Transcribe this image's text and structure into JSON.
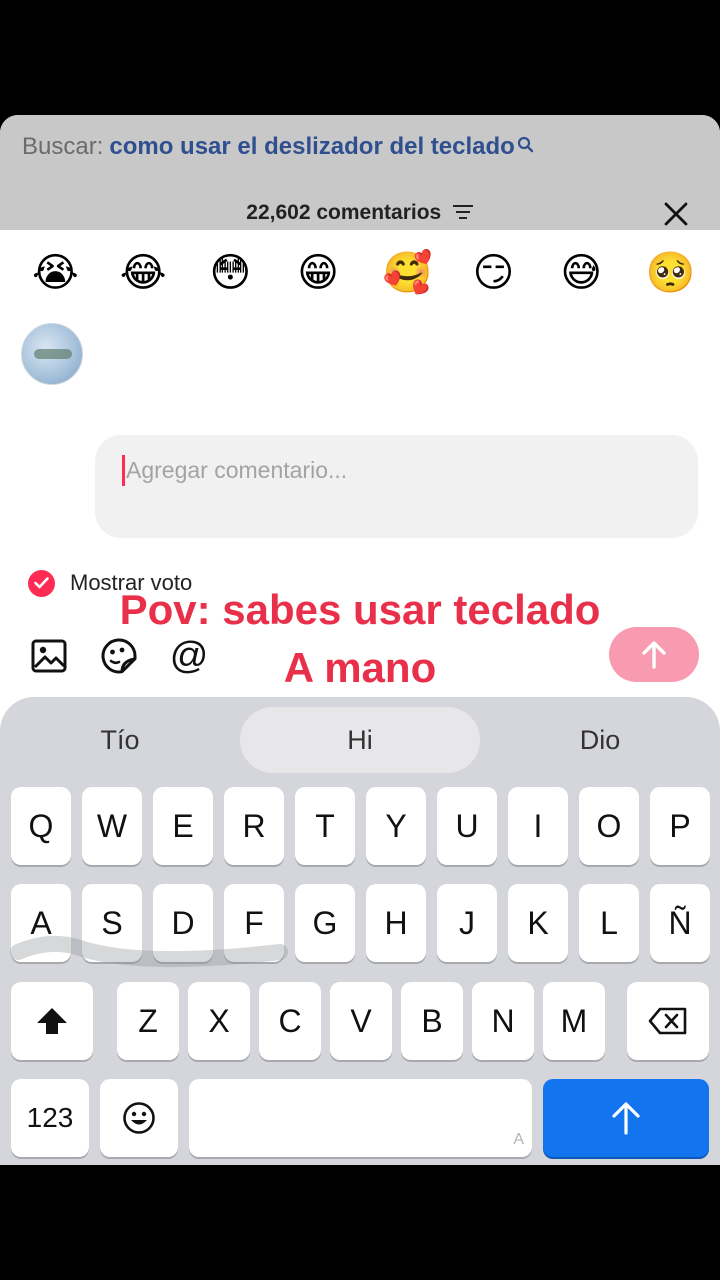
{
  "search": {
    "prefix": "Buscar:",
    "query": "como usar el deslizador del teclado"
  },
  "comments": {
    "count_label": "22,602 comentarios"
  },
  "emojis": [
    "😭",
    "😂",
    "😳",
    "😁",
    "🥰",
    "😏",
    "😅",
    "🥺"
  ],
  "input": {
    "placeholder": "Agregar comentario..."
  },
  "vote": {
    "label": "Mostrar voto",
    "checked": true
  },
  "overlay": {
    "line1": "Pov: sabes usar teclado",
    "line2": "A mano"
  },
  "keyboard": {
    "predictions": [
      "Tío",
      "Hi",
      "Dio"
    ],
    "row1": [
      "Q",
      "W",
      "E",
      "R",
      "T",
      "Y",
      "U",
      "I",
      "O",
      "P"
    ],
    "row2": [
      "A",
      "S",
      "D",
      "F",
      "G",
      "H",
      "J",
      "K",
      "L",
      "Ñ"
    ],
    "row3": [
      "Z",
      "X",
      "C",
      "V",
      "B",
      "N",
      "M"
    ],
    "numbers_label": "123",
    "space_hint": "A"
  },
  "colors": {
    "accent": "#fe2c55",
    "overlay_text": "#e8304a",
    "return_key": "#1374ef",
    "send_button": "#f89ab0"
  }
}
